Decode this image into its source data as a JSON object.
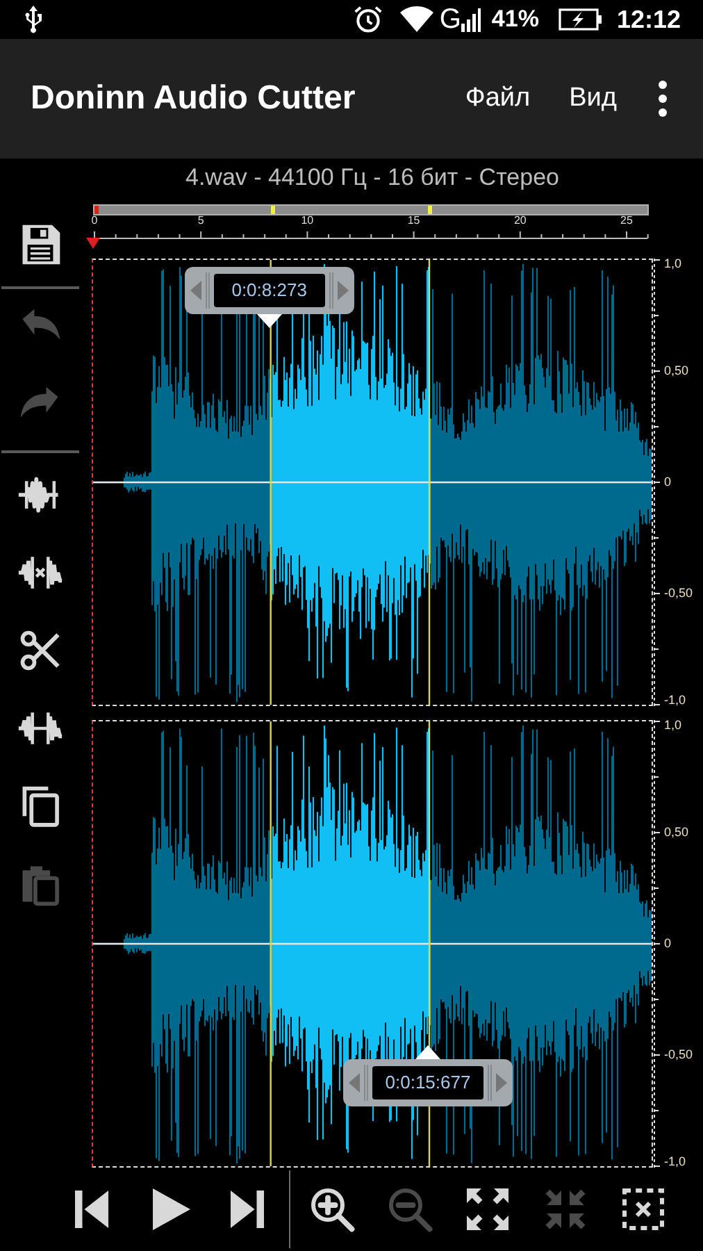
{
  "status_bar": {
    "network": "G",
    "battery": "41%",
    "time": "12:12"
  },
  "app_bar": {
    "title": "Doninn Audio Cutter",
    "menu": [
      "Файл",
      "Вид"
    ]
  },
  "file_info": "4.wav - 44100 Гц - 16 бит - Стерео",
  "side_tools": [
    {
      "kind": "save",
      "disabled": false
    },
    {
      "kind": "separator"
    },
    {
      "kind": "undo",
      "disabled": true
    },
    {
      "kind": "redo",
      "disabled": true
    },
    {
      "kind": "separator"
    },
    {
      "kind": "trim",
      "disabled": false
    },
    {
      "kind": "delete",
      "disabled": false
    },
    {
      "kind": "cut",
      "disabled": false
    },
    {
      "kind": "silence",
      "disabled": false
    },
    {
      "kind": "copy",
      "disabled": false
    },
    {
      "kind": "paste",
      "disabled": true
    }
  ],
  "timeline": {
    "ticks": [
      "0",
      "5",
      "10",
      "15",
      "20",
      "25"
    ]
  },
  "channels": [
    {
      "axis": [
        "1,0",
        "0,50",
        "0",
        "-0,50",
        "-1,0"
      ]
    },
    {
      "axis": [
        "1,0",
        "0,50",
        "0",
        "-0,50",
        "-1,0"
      ]
    }
  ],
  "markers": [
    {
      "time": "0:0:8:273",
      "level": 0.318,
      "kind": "start"
    },
    {
      "time": "0:0:15:677",
      "level": 0.602,
      "kind": "end"
    }
  ],
  "bottom_tools": [
    {
      "kind": "prev",
      "disabled": false
    },
    {
      "kind": "play",
      "disabled": false
    },
    {
      "kind": "next",
      "disabled": false
    },
    {
      "kind": "separator"
    },
    {
      "kind": "zoom_in",
      "disabled": false
    },
    {
      "kind": "zoom_out",
      "disabled": true
    },
    {
      "kind": "expand",
      "disabled": false
    },
    {
      "kind": "shrink",
      "disabled": true
    },
    {
      "kind": "deselect",
      "disabled": false
    }
  ]
}
